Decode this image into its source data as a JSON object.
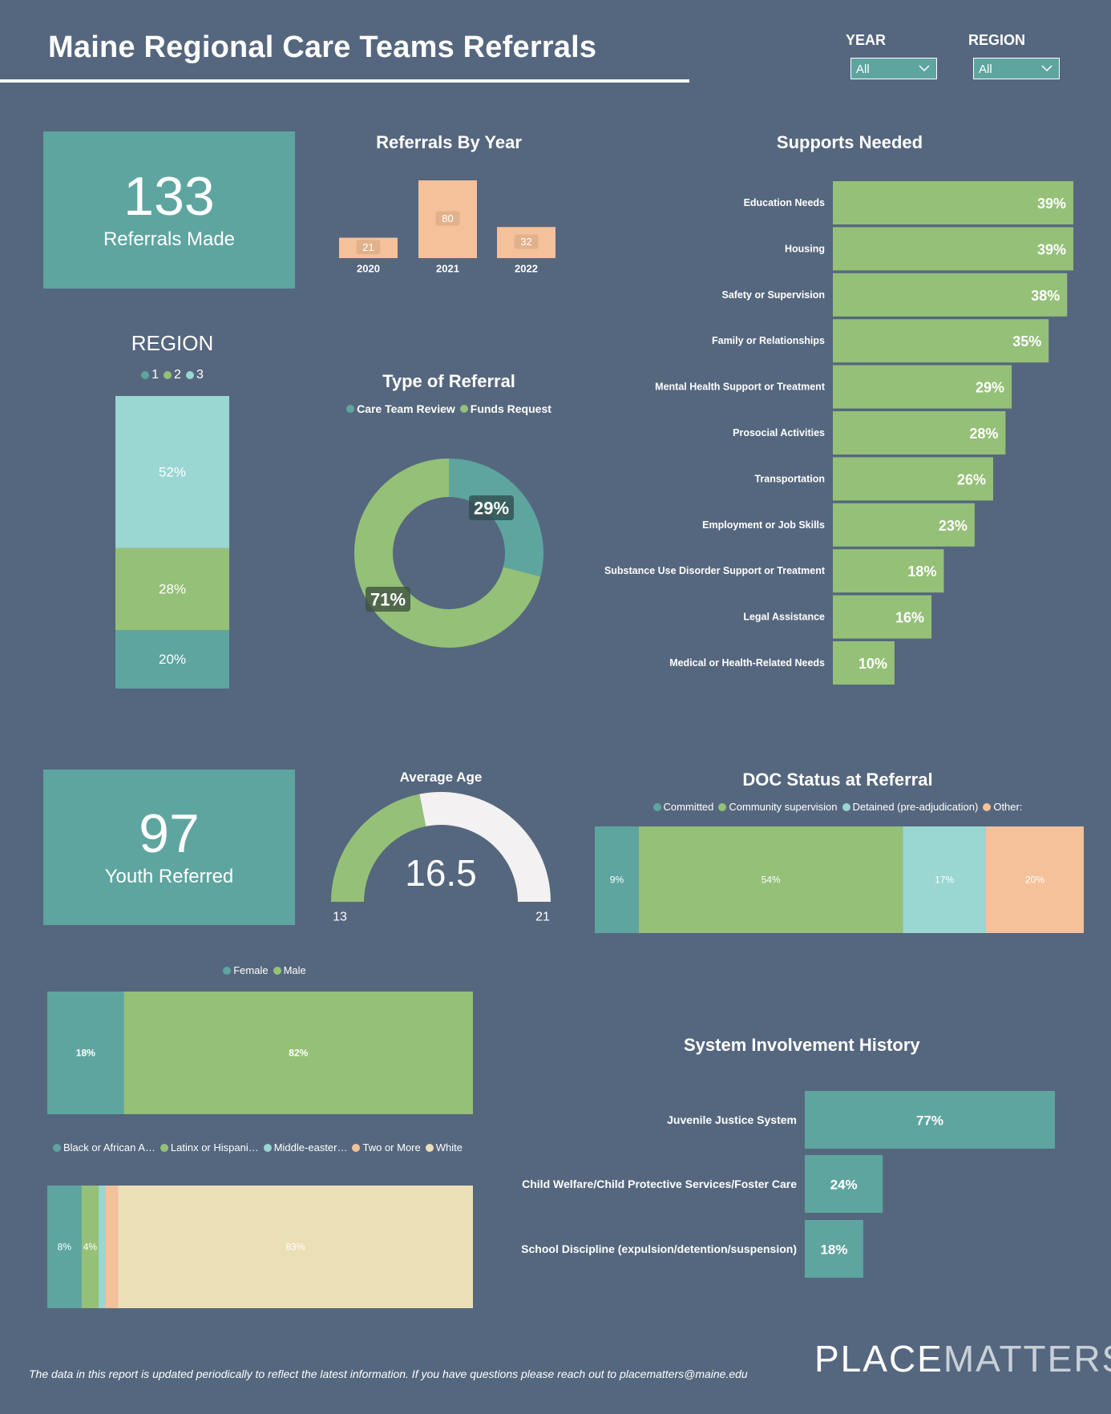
{
  "header": {
    "title": "Maine Regional Care Teams Referrals",
    "filters": [
      {
        "label": "YEAR",
        "value": "All"
      },
      {
        "label": "REGION",
        "value": "All"
      }
    ]
  },
  "colors": {
    "background": "#55677e",
    "teal": "#5ea5a0",
    "green": "#95c078",
    "light_teal": "#9ad6d2",
    "peach": "#f5c19a",
    "cream": "#ebdfb6",
    "gauge_track": "#f3f1f1"
  },
  "kpis": {
    "referrals": {
      "value": "133",
      "label": "Referrals Made"
    },
    "youth": {
      "value": "97",
      "label": "Youth Referred"
    }
  },
  "footer": {
    "note": "The data in this report is updated periodically to reflect the latest information. If you have questions please reach out to placematters@maine.edu",
    "logo_bold": "PLACE",
    "logo_thin": "MATTERS"
  },
  "chart_data": [
    {
      "id": "referrals_by_year",
      "type": "bar",
      "title": "Referrals By Year",
      "categories": [
        "2020",
        "2021",
        "2022"
      ],
      "values": [
        21,
        80,
        32
      ],
      "xlabel": "",
      "ylabel": "",
      "ylim": [
        0,
        80
      ],
      "grid": false
    },
    {
      "id": "region",
      "type": "bar",
      "stacked": true,
      "title": "REGION",
      "legend": [
        "1",
        "2",
        "3"
      ],
      "legend_position": "top",
      "series": [
        {
          "name": "1",
          "value": 20,
          "label": "20%"
        },
        {
          "name": "2",
          "value": 28,
          "label": "28%"
        },
        {
          "name": "3",
          "value": 52,
          "label": "52%"
        }
      ]
    },
    {
      "id": "type_of_referral",
      "type": "pie",
      "donut": true,
      "title": "Type of Referral",
      "legend": [
        "Care Team Review",
        "Funds Request"
      ],
      "legend_position": "top",
      "slices": [
        {
          "name": "Care Team Review",
          "value": 29,
          "label": "29%"
        },
        {
          "name": "Funds Request",
          "value": 71,
          "label": "71%"
        }
      ]
    },
    {
      "id": "supports_needed",
      "type": "bar",
      "orientation": "horizontal",
      "title": "Supports Needed",
      "categories": [
        "Education Needs",
        "Housing",
        "Safety or Supervision",
        "Family or Relationships",
        "Mental Health Support or Treatment",
        "Prosocial Activities",
        "Transportation",
        "Employment or Job Skills",
        "Substance Use Disorder Support or Treatment",
        "Legal Assistance",
        "Medical or Health-Related Needs"
      ],
      "values": [
        39,
        39,
        38,
        35,
        29,
        28,
        26,
        23,
        18,
        16,
        10
      ],
      "labels": [
        "39%",
        "39%",
        "38%",
        "35%",
        "29%",
        "28%",
        "26%",
        "23%",
        "18%",
        "16%",
        "10%"
      ],
      "xlim": [
        0,
        39
      ]
    },
    {
      "id": "average_age",
      "type": "gauge",
      "title": "Average Age",
      "value": 16.5,
      "value_label": "16.5",
      "min": 13,
      "max": 21,
      "min_label": "13",
      "max_label": "21"
    },
    {
      "id": "doc_status",
      "type": "bar",
      "stacked": true,
      "orientation": "horizontal",
      "title": "DOC Status at Referral",
      "legend": [
        "Committed",
        "Community supervision",
        "Detained (pre-adjudication)",
        "Other:"
      ],
      "legend_position": "top",
      "series": [
        {
          "name": "Committed",
          "value": 9,
          "label": "9%"
        },
        {
          "name": "Community supervision",
          "value": 54,
          "label": "54%"
        },
        {
          "name": "Detained (pre-adjudication)",
          "value": 17,
          "label": "17%"
        },
        {
          "name": "Other:",
          "value": 20,
          "label": "20%"
        }
      ]
    },
    {
      "id": "gender",
      "type": "bar",
      "stacked": true,
      "orientation": "horizontal",
      "title": "",
      "legend": [
        "Female",
        "Male"
      ],
      "legend_position": "top",
      "series": [
        {
          "name": "Female",
          "value": 18,
          "label": "18%"
        },
        {
          "name": "Male",
          "value": 82,
          "label": "82%"
        }
      ]
    },
    {
      "id": "race_ethnicity",
      "type": "bar",
      "stacked": true,
      "orientation": "horizontal",
      "title": "",
      "legend": [
        "Black or African A…",
        "Latinx or Hispani…",
        "Middle-easter…",
        "Two or More",
        "White"
      ],
      "legend_position": "top",
      "series": [
        {
          "name": "Black or African A…",
          "value": 8,
          "label": "8%"
        },
        {
          "name": "Latinx or Hispani…",
          "value": 4,
          "label": "4%"
        },
        {
          "name": "Middle-easter…",
          "value": 1.5,
          "label": ""
        },
        {
          "name": "Two or More",
          "value": 3,
          "label": ""
        },
        {
          "name": "White",
          "value": 83,
          "label": "83%"
        }
      ]
    },
    {
      "id": "system_involvement",
      "type": "bar",
      "orientation": "horizontal",
      "title": "System Involvement History",
      "categories": [
        "Juvenile Justice System",
        "Child Welfare/Child Protective Services/Foster Care",
        "School Discipline (expulsion/detention/suspension)"
      ],
      "values": [
        77,
        24,
        18
      ],
      "labels": [
        "77%",
        "24%",
        "18%"
      ],
      "xlim": [
        0,
        77
      ]
    }
  ]
}
